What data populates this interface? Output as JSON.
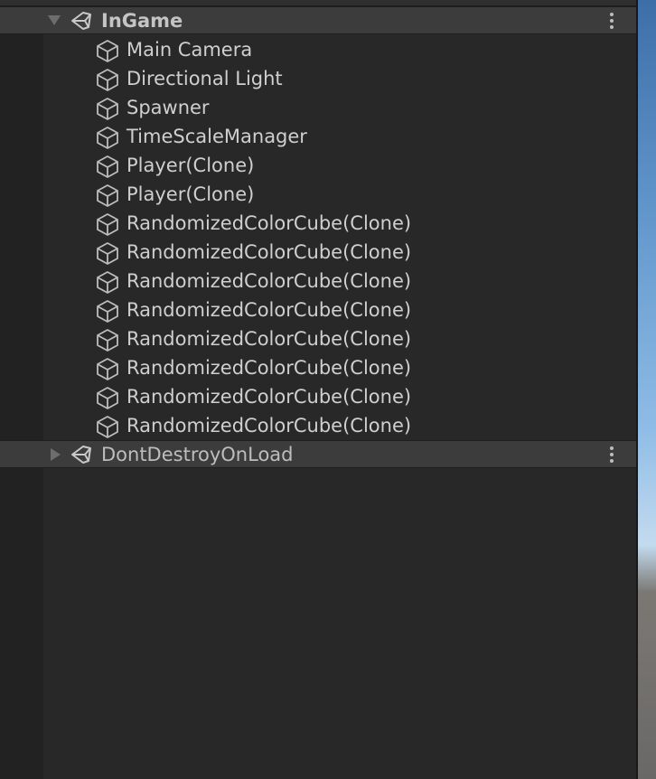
{
  "hierarchy": {
    "scenes": [
      {
        "name": "InGame",
        "expanded": true,
        "children": [
          "Main Camera",
          "Directional Light",
          "Spawner",
          "TimeScaleManager",
          "Player(Clone)",
          "Player(Clone)",
          "RandomizedColorCube(Clone)",
          "RandomizedColorCube(Clone)",
          "RandomizedColorCube(Clone)",
          "RandomizedColorCube(Clone)",
          "RandomizedColorCube(Clone)",
          "RandomizedColorCube(Clone)",
          "RandomizedColorCube(Clone)",
          "RandomizedColorCube(Clone)"
        ]
      },
      {
        "name": "DontDestroyOnLoad",
        "expanded": false,
        "children": []
      }
    ]
  },
  "icons": {
    "scene": "unity-scene-icon",
    "gameobject": "gameobject-cube-icon",
    "menu": "kebab-menu-icon"
  },
  "colors": {
    "panel_bg": "#282828",
    "scene_header_bg": "#3c3c3c",
    "text": "#cfcfcf"
  }
}
